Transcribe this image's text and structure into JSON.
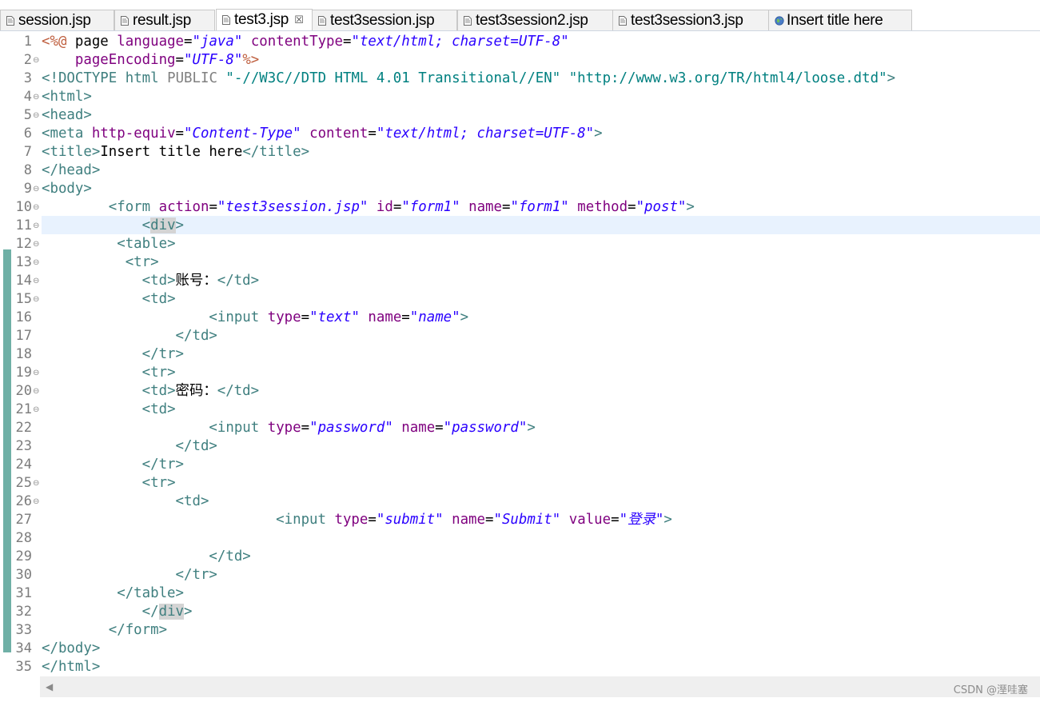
{
  "tabs": [
    {
      "label": "session.jsp",
      "icon": "jsp-file-icon",
      "active": false
    },
    {
      "label": "result.jsp",
      "icon": "jsp-file-icon",
      "active": false
    },
    {
      "label": "test3.jsp",
      "icon": "jsp-file-icon",
      "active": true,
      "close": "☒"
    },
    {
      "label": "test3session.jsp",
      "icon": "jsp-file-icon",
      "active": false
    },
    {
      "label": "test3session2.jsp",
      "icon": "jsp-file-icon",
      "active": false
    },
    {
      "label": "test3session3.jsp",
      "icon": "jsp-file-icon",
      "active": false
    },
    {
      "label": "Insert title here",
      "icon": "globe-icon",
      "active": false
    }
  ],
  "editor": {
    "current_line": 11,
    "lines": [
      {
        "n": "1",
        "fold": "",
        "code": "<%@ page language=\"java\" contentType=\"text/html; charset=UTF-8\""
      },
      {
        "n": "2",
        "fold": "⊖",
        "code": "    pageEncoding=\"UTF-8\"%>"
      },
      {
        "n": "3",
        "fold": "",
        "code": "<!DOCTYPE html PUBLIC \"-//W3C//DTD HTML 4.01 Transitional//EN\" \"http://www.w3.org/TR/html4/loose.dtd\">"
      },
      {
        "n": "4",
        "fold": "⊖",
        "code": "<html>"
      },
      {
        "n": "5",
        "fold": "⊖",
        "code": "<head>"
      },
      {
        "n": "6",
        "fold": "",
        "code": "<meta http-equiv=\"Content-Type\" content=\"text/html; charset=UTF-8\">"
      },
      {
        "n": "7",
        "fold": "",
        "code": "<title>Insert title here</title>"
      },
      {
        "n": "8",
        "fold": "",
        "code": "</head>"
      },
      {
        "n": "9",
        "fold": "⊖",
        "code": "<body>"
      },
      {
        "n": "10",
        "fold": "⊖",
        "code": "        <form action=\"test3session.jsp\" id=\"form1\" name=\"form1\" method=\"post\">"
      },
      {
        "n": "11",
        "fold": "⊖",
        "code": "            <div>"
      },
      {
        "n": "12",
        "fold": "⊖",
        "code": "         <table>"
      },
      {
        "n": "13",
        "fold": "⊖",
        "code": "          <tr>"
      },
      {
        "n": "14",
        "fold": "⊖",
        "code": "            <td>账号：</td>"
      },
      {
        "n": "15",
        "fold": "⊖",
        "code": "            <td>"
      },
      {
        "n": "16",
        "fold": "",
        "code": "                    <input type=\"text\" name=\"name\">"
      },
      {
        "n": "17",
        "fold": "",
        "code": "                </td>"
      },
      {
        "n": "18",
        "fold": "",
        "code": "            </tr>"
      },
      {
        "n": "19",
        "fold": "⊖",
        "code": "            <tr>"
      },
      {
        "n": "20",
        "fold": "⊖",
        "code": "            <td>密码：</td>"
      },
      {
        "n": "21",
        "fold": "⊖",
        "code": "            <td>"
      },
      {
        "n": "22",
        "fold": "",
        "code": "                    <input type=\"password\" name=\"password\">"
      },
      {
        "n": "23",
        "fold": "",
        "code": "                </td>"
      },
      {
        "n": "24",
        "fold": "",
        "code": "            </tr>"
      },
      {
        "n": "25",
        "fold": "⊖",
        "code": "            <tr>"
      },
      {
        "n": "26",
        "fold": "⊖",
        "code": "                <td>"
      },
      {
        "n": "27",
        "fold": "",
        "code": "                            <input type=\"submit\" name=\"Submit\" value=\"登录\">"
      },
      {
        "n": "28",
        "fold": "",
        "code": ""
      },
      {
        "n": "29",
        "fold": "",
        "code": "                    </td>"
      },
      {
        "n": "30",
        "fold": "",
        "code": "                </tr>"
      },
      {
        "n": "31",
        "fold": "",
        "code": "         </table>"
      },
      {
        "n": "32",
        "fold": "",
        "code": "            </div>"
      },
      {
        "n": "33",
        "fold": "",
        "code": "        </form>"
      },
      {
        "n": "34",
        "fold": "",
        "code": "</body>"
      },
      {
        "n": "35",
        "fold": "",
        "code": "</html>"
      }
    ]
  },
  "scrollbar": {
    "left_arrow": "◀"
  },
  "watermark": "CSDN @溼哇塞",
  "colors": {
    "tag": "#3f7f7f",
    "attr": "#7f007f",
    "string": "#2a00ff",
    "directive": "#bf5f3f",
    "current_line": "#e8f2fe",
    "change_bar": "#6fb0a6"
  }
}
